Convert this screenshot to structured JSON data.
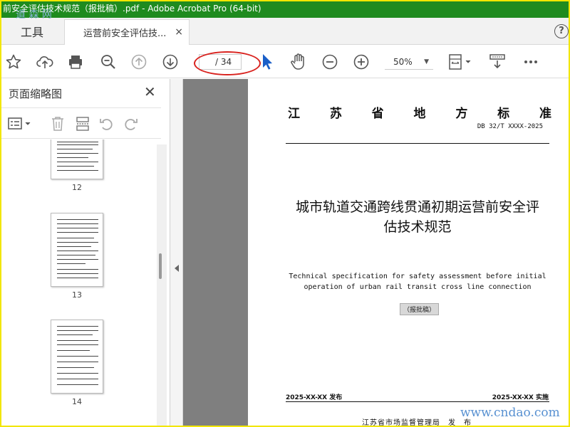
{
  "window": {
    "title": "前安全评估技术规范（报批稿）.pdf - Adobe Acrobat Pro (64-bit)"
  },
  "tabs": {
    "tools_label": "工具",
    "doc_tab_label": "运营前安全评估技...",
    "close_glyph": "×",
    "help_glyph": "?"
  },
  "toolbar": {
    "icons": [
      "star-icon",
      "cloud-upload-icon",
      "print-icon",
      "zoom-out-search-icon",
      "page-up-icon",
      "page-down-icon",
      "select-cursor-icon",
      "hand-icon",
      "zoom-out-icon",
      "zoom-in-icon",
      "fit-page-icon",
      "scroll-mode-icon",
      "more-icon"
    ],
    "page_current": "",
    "page_total": "/ 34",
    "zoom": "50%"
  },
  "sidebar": {
    "title": "页面缩略图",
    "close_glyph": "✕",
    "thumbnails": [
      {
        "label": "12"
      },
      {
        "label": "13"
      },
      {
        "label": "14"
      }
    ]
  },
  "document": {
    "header_chars": [
      "江",
      "苏",
      "省",
      "地",
      "方",
      "标",
      "准"
    ],
    "code": "DB 32/T XXXX-2025",
    "title_line1": "城市轨道交通跨线贯通初期运营前安全评",
    "title_line2": "估技术规范",
    "eng_line1": "Technical specification for safety assessment before initial",
    "eng_line2": "operation of urban rail transit cross line connection",
    "draft_label": "（报批稿）",
    "date_left": "2025-XX-XX 发布",
    "date_right": "2025-XX-XX 实施",
    "issuer": "江苏省市场监督管理局　发　布"
  },
  "watermarks": {
    "top": "道 森 网",
    "bottom": "www.cndao.com"
  },
  "colors": {
    "title_bar": "#1f8b1f",
    "frame": "#f2e600",
    "highlight": "#d9231f",
    "select_cursor": "#1a5fc8"
  }
}
